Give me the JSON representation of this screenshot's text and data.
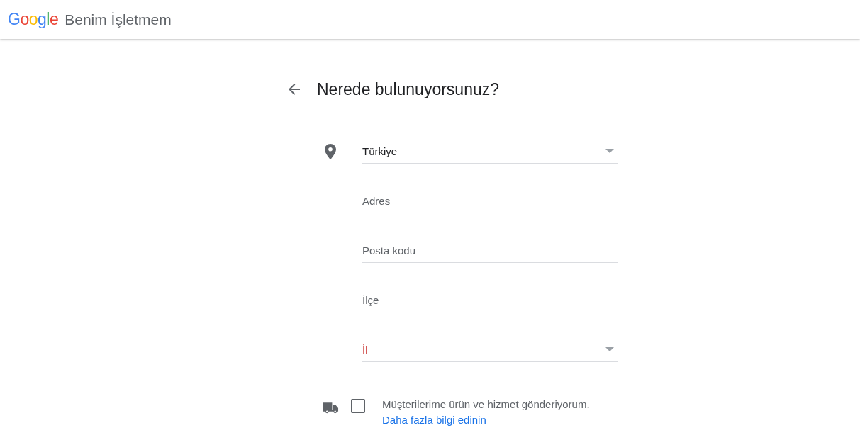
{
  "header": {
    "logo": "Google",
    "product": "Benim İşletmem"
  },
  "page": {
    "title": "Nerede bulunuyorsunuz?"
  },
  "fields": [
    {
      "kind": "select",
      "value": "Türkiye",
      "invalid": false
    },
    {
      "kind": "text",
      "placeholder": "Adres",
      "invalid": false
    },
    {
      "kind": "text",
      "placeholder": "Posta kodu",
      "invalid": false
    },
    {
      "kind": "text",
      "placeholder": "İlçe",
      "invalid": false
    },
    {
      "kind": "select",
      "placeholder": "İl",
      "invalid": true
    }
  ],
  "delivery": {
    "checked": false,
    "label": "Müşterilerime ürün ve hizmet gönderiyorum.",
    "link": "Daha fazla bilgi edinin"
  }
}
